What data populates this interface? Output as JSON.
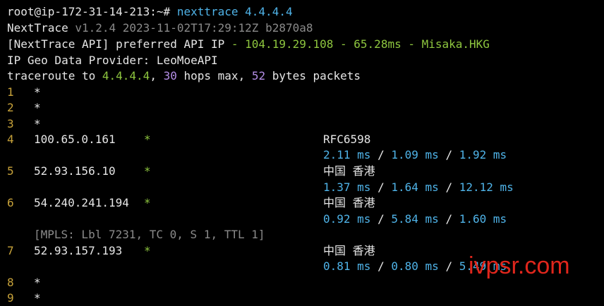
{
  "prompt": {
    "user_host": "root@ip-172-31-14-213:~#",
    "command": "nexttrace 4.4.4.4"
  },
  "header": {
    "app_name": "NextTrace",
    "version_line": "v1.2.4 2023-11-02T17:29:12Z b2870a8",
    "api_prefix": "[NextTrace API] preferred API IP",
    "api_info": "- 104.19.29.108 - 65.28ms - Misaka.HKG",
    "geo_provider": "IP Geo Data Provider: LeoMoeAPI",
    "trace_prefix": "traceroute to",
    "trace_target": "4.4.4.4",
    "trace_comma1": ",",
    "trace_hops": "30",
    "trace_hops_text": "hops max,",
    "trace_bytes": "52",
    "trace_bytes_text": "bytes packets"
  },
  "hops": {
    "h1": {
      "num": "1",
      "star": "*"
    },
    "h2": {
      "num": "2",
      "star": "*"
    },
    "h3": {
      "num": "3",
      "star": "*"
    },
    "h4": {
      "num": "4",
      "ip": "100.65.0.161",
      "star": "*",
      "geo": "RFC6598",
      "t1": "2.11 ms",
      "t2": "1.09 ms",
      "t3": "1.92 ms"
    },
    "h5": {
      "num": "5",
      "ip": "52.93.156.10",
      "star": "*",
      "geo": "中国 香港",
      "t1": "1.37 ms",
      "t2": "1.64 ms",
      "t3": "12.12 ms"
    },
    "h6": {
      "num": "6",
      "ip": "54.240.241.194",
      "star": "*",
      "geo": "中国 香港",
      "t1": "0.92 ms",
      "t2": "5.84 ms",
      "t3": "1.60 ms",
      "mpls": "[MPLS: Lbl 7231, TC 0, S 1, TTL 1]"
    },
    "h7": {
      "num": "7",
      "ip": "52.93.157.193",
      "star": "*",
      "geo": "中国 香港",
      "t1": "0.81 ms",
      "t2": "0.80 ms",
      "t3": "5.49 ms"
    },
    "h8": {
      "num": "8",
      "star": "*"
    },
    "h9": {
      "num": "9",
      "star": "*"
    }
  },
  "separator": "/",
  "watermark": "ivpsr.com",
  "colors": {
    "background": "#000000",
    "green": "#8ec63f",
    "blue": "#4fb3e8",
    "purple": "#b48ee6",
    "hop_number": "#c7a23a",
    "gray": "#8a8a8a",
    "watermark": "#e0261c"
  }
}
